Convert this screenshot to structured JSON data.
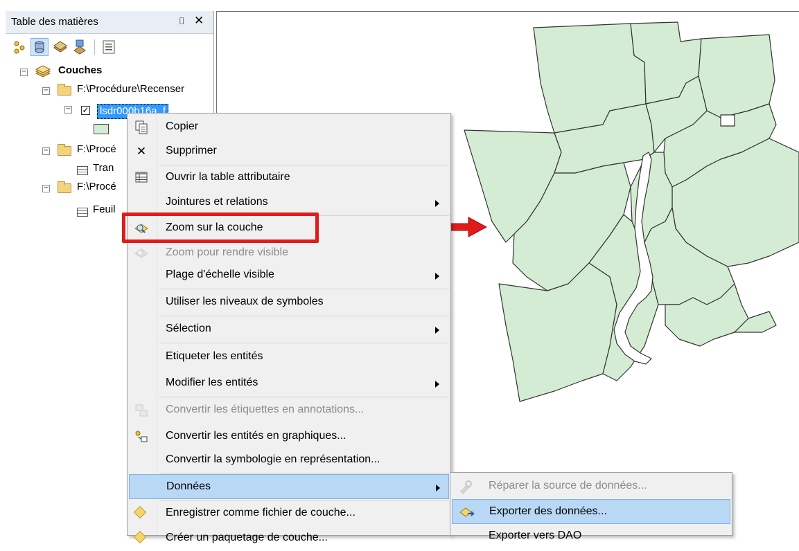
{
  "toc": {
    "title": "Table des matières",
    "pin_glyph": "⌷",
    "close_glyph": "✕",
    "root_label": "Couches",
    "group1_label": "F:\\Procédure\\Recenser",
    "layer_label": "lsdr000b16a_f",
    "group2_label": "F:\\Procé",
    "table1_label": "Tran",
    "group3_label": "F:\\Procé",
    "table2_label": "Feuil",
    "collapse_glyph": "−",
    "check_glyph": "✓"
  },
  "context_menu": {
    "items": [
      {
        "label": "Copier",
        "icon": "copy-icon",
        "enabled": true
      },
      {
        "label": "Supprimer",
        "icon": "delete-icon",
        "enabled": true
      },
      {
        "label": "Ouvrir la table attributaire",
        "icon": "table-icon",
        "enabled": true
      },
      {
        "label": "Jointures et relations",
        "submenu": true,
        "enabled": true
      },
      {
        "label": "Zoom sur la couche",
        "icon": "zoom-layer-icon",
        "enabled": true,
        "highlighted_box": true
      },
      {
        "label": "Zoom pour rendre visible",
        "icon": "zoom-visible-icon",
        "enabled": false
      },
      {
        "label": "Plage d'échelle visible",
        "submenu": true,
        "enabled": true
      },
      {
        "label": "Utiliser les niveaux de symboles",
        "enabled": true
      },
      {
        "label": "Sélection",
        "submenu": true,
        "enabled": true
      },
      {
        "label": "Etiqueter les entités",
        "enabled": true
      },
      {
        "label": "Modifier les entités",
        "submenu": true,
        "enabled": true
      },
      {
        "label": "Convertir les étiquettes en annotations...",
        "icon": "convert-labels-icon",
        "enabled": false
      },
      {
        "label": "Convertir les entités en graphiques...",
        "icon": "convert-graphics-icon",
        "enabled": true
      },
      {
        "label": "Convertir la symbologie en représentation...",
        "enabled": true
      },
      {
        "label": "Données",
        "submenu": true,
        "enabled": true,
        "selected": true
      },
      {
        "label": "Enregistrer comme fichier de couche...",
        "icon": "layer-file-icon",
        "enabled": true
      },
      {
        "label": "Créer un paquetage de couche...",
        "icon": "layer-package-icon",
        "enabled": true
      }
    ]
  },
  "submenu": {
    "items": [
      {
        "label": "Réparer la source de données...",
        "icon": "repair-icon",
        "enabled": false
      },
      {
        "label": "Exporter des données...",
        "icon": "export-icon",
        "enabled": true,
        "selected": true
      },
      {
        "label": "Exporter vers DAO",
        "enabled": true
      }
    ]
  },
  "colors": {
    "polygon_fill": "#d3ecd3",
    "highlight_red": "#e01b1b",
    "menu_selected": "#b9d8f5",
    "tree_selected": "#3399ff"
  }
}
